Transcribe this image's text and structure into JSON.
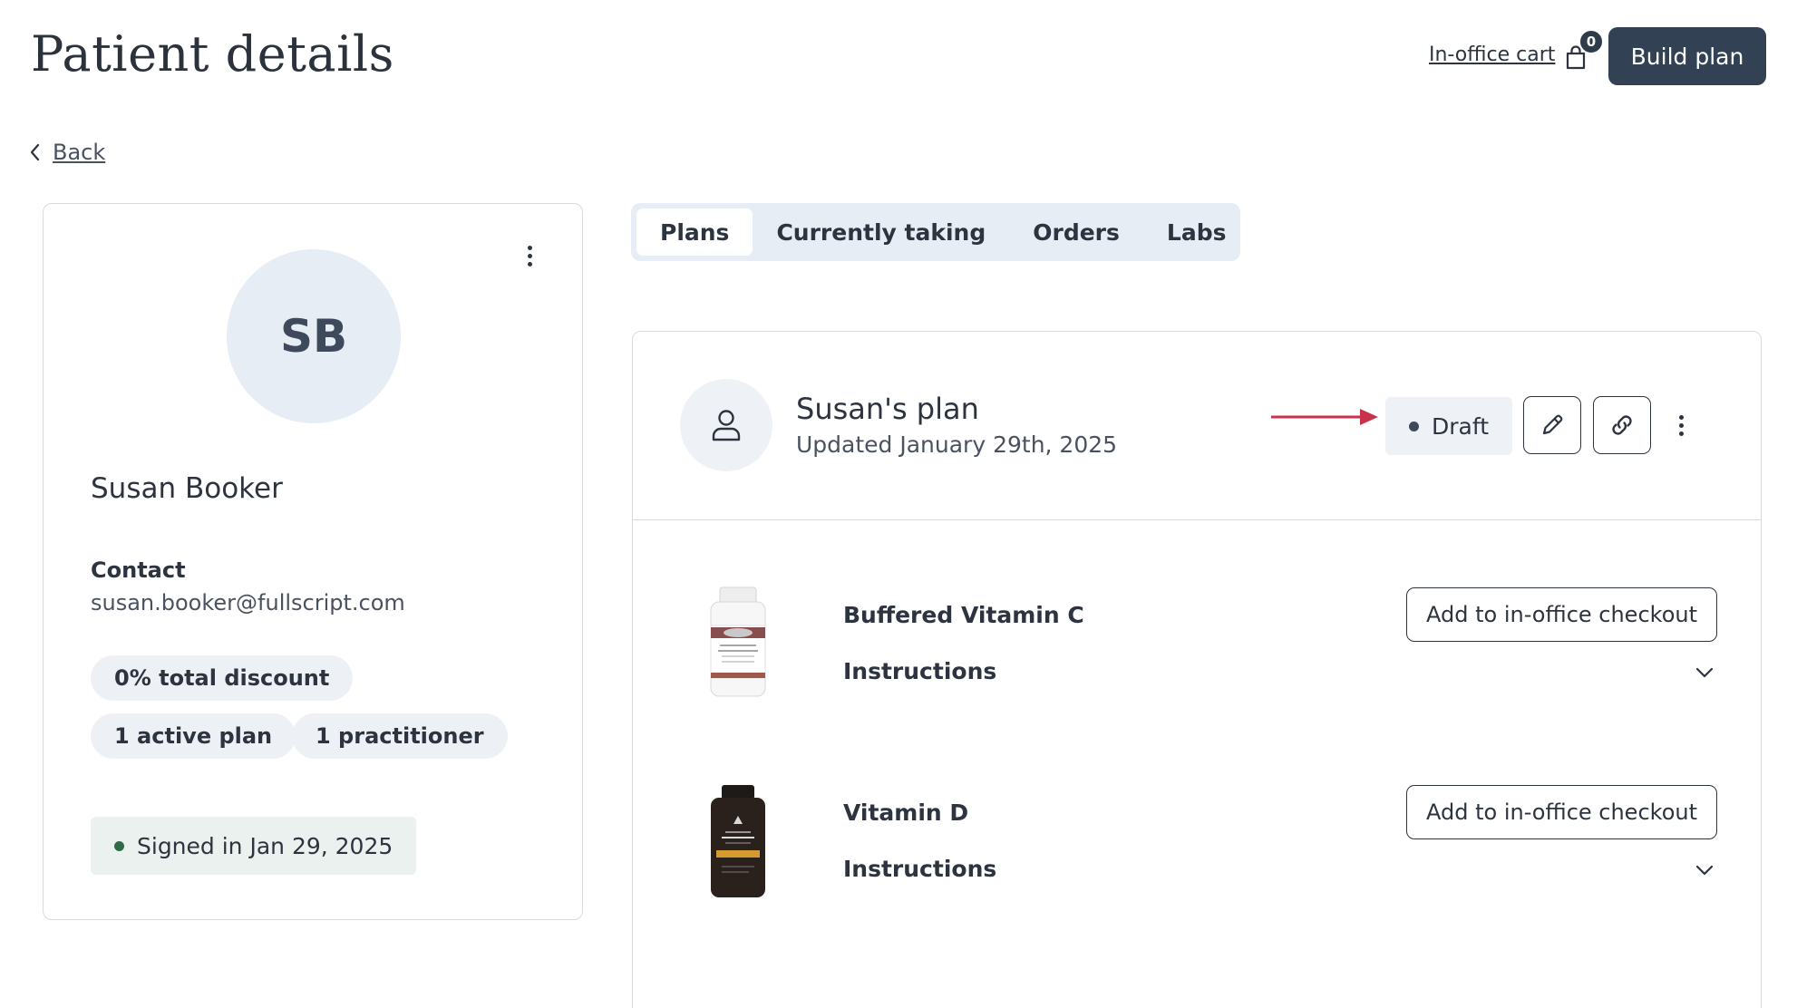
{
  "header": {
    "title": "Patient details",
    "cart_label": "In-office cart",
    "cart_count": "0",
    "build_plan_label": "Build plan"
  },
  "nav": {
    "back_label": "Back"
  },
  "patient": {
    "initials": "SB",
    "name": "Susan Booker",
    "contact_label": "Contact",
    "email": "susan.booker@fullscript.com",
    "discount": "0% total discount",
    "active_plans": "1 active plan",
    "practitioners": "1 practitioner",
    "signed_in": "Signed in Jan 29, 2025",
    "signed_in_color": "#2f6b44"
  },
  "tabs": [
    {
      "label": "Plans",
      "active": true
    },
    {
      "label": "Currently taking",
      "active": false
    },
    {
      "label": "Orders",
      "active": false
    },
    {
      "label": "Labs",
      "active": false
    }
  ],
  "plan": {
    "title": "Susan's plan",
    "updated": "Updated January 29th, 2025",
    "status": "Draft",
    "arrow_color": "#c8324a",
    "items": [
      {
        "name": "Buffered Vitamin C",
        "instructions_label": "Instructions",
        "checkout_label": "Add to in-office checkout",
        "image_icon": "white-supplement-bottle"
      },
      {
        "name": "Vitamin D",
        "instructions_label": "Instructions",
        "checkout_label": "Add to in-office checkout",
        "image_icon": "dark-supplement-bottle"
      }
    ]
  }
}
